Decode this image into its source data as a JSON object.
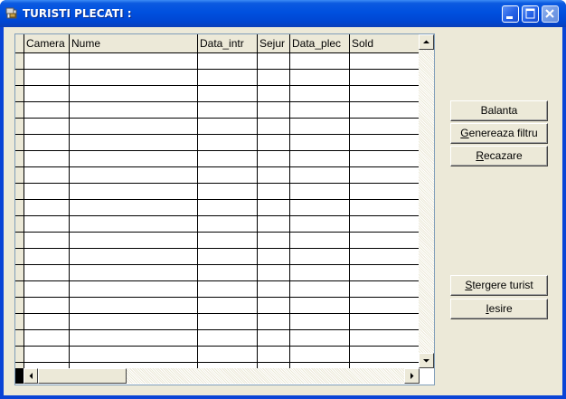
{
  "window": {
    "title": "TURISTI PLECATI :"
  },
  "grid": {
    "columns": [
      "Camera",
      "Nume",
      "Data_intr",
      "Sejur",
      "Data_plec",
      "Sold"
    ],
    "rows": []
  },
  "buttons": {
    "balanta": {
      "label": "Balanta",
      "accel": ""
    },
    "genereaza": {
      "label_pre": "",
      "accel": "G",
      "label_post": "enereaza filtru"
    },
    "recazare": {
      "label_pre": "",
      "accel": "R",
      "label_post": "ecazare"
    },
    "stergere": {
      "label_pre": "",
      "accel": "S",
      "label_post": "tergere turist"
    },
    "iesire": {
      "label_pre": "",
      "accel": "I",
      "label_post": "esire"
    }
  },
  "icons": {
    "app": "app-icon",
    "minimize": "minimize-icon",
    "maximize": "maximize-icon",
    "close": "close-icon",
    "scroll_up": "arrow-up-icon",
    "scroll_down": "arrow-down-icon",
    "scroll_left": "arrow-left-icon",
    "scroll_right": "arrow-right-icon"
  },
  "colors": {
    "titlebar": "#0054e3",
    "client": "#ece9d8"
  }
}
